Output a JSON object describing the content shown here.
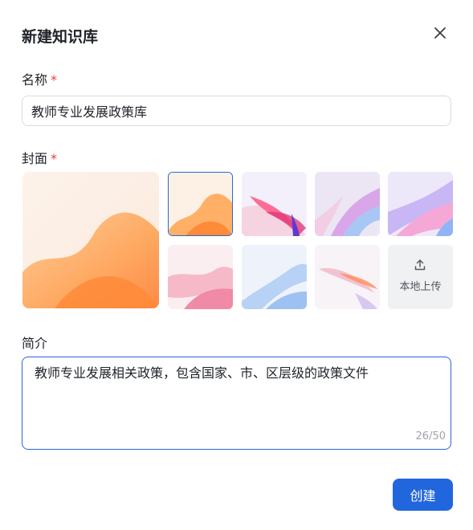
{
  "dialog": {
    "title": "新建知识库",
    "close_icon": "close-icon"
  },
  "name": {
    "label": "名称",
    "required_mark": "*",
    "value": "教师专业发展政策库"
  },
  "cover": {
    "label": "封面",
    "required_mark": "*",
    "upload_label": "本地上传",
    "upload_icon": "upload-icon"
  },
  "description": {
    "label": "简介",
    "value": "教师专业发展相关政策，包含国家、市、区层级的政策文件",
    "counter": "26/50"
  },
  "footer": {
    "create_label": "创建",
    "accent": "#2266dd"
  }
}
